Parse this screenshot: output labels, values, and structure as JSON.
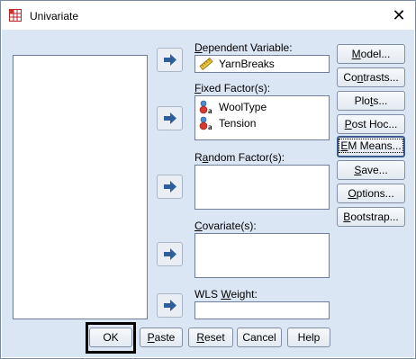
{
  "window": {
    "title": "Univariate",
    "close_glyph": "✕"
  },
  "fields": {
    "dependent": {
      "label": "Dependent Variable:",
      "underline": "D",
      "rest": "ependent Variable:",
      "items": [
        "YarnBreaks"
      ]
    },
    "fixed": {
      "label": "Fixed Factor(s):",
      "underline": "F",
      "rest": "ixed Factor(s):",
      "items": [
        "WoolType",
        "Tension"
      ]
    },
    "random": {
      "label": "Random Factor(s):",
      "pre": "R",
      "underline": "a",
      "rest": "ndom Factor(s):"
    },
    "covariate": {
      "label": "Covariate(s):",
      "underline": "C",
      "rest": "ovariate(s):"
    },
    "wls": {
      "label": "WLS Weight:",
      "pre": "WLS ",
      "underline": "W",
      "rest": "eight:"
    }
  },
  "side_buttons": [
    {
      "label": "Model...",
      "pre": "",
      "u": "M",
      "rest": "odel..."
    },
    {
      "label": "Contrasts...",
      "pre": "Co",
      "u": "n",
      "rest": "trasts..."
    },
    {
      "label": "Plots...",
      "pre": "Plo",
      "u": "t",
      "rest": "s..."
    },
    {
      "label": "Post Hoc...",
      "pre": "",
      "u": "P",
      "rest": "ost Hoc..."
    },
    {
      "label": "EM Means...",
      "pre": "",
      "u": "E",
      "rest": "M Means..."
    },
    {
      "label": "Save...",
      "pre": "",
      "u": "S",
      "rest": "ave..."
    },
    {
      "label": "Options...",
      "pre": "",
      "u": "O",
      "rest": "ptions..."
    },
    {
      "label": "Bootstrap...",
      "pre": "",
      "u": "B",
      "rest": "ootstrap..."
    }
  ],
  "bottom_buttons": {
    "ok": "OK",
    "paste": {
      "u": "P",
      "rest": "aste"
    },
    "reset": {
      "u": "R",
      "rest": "eset"
    },
    "cancel": "Cancel",
    "help": "Help"
  },
  "colors": {
    "client_bg": "#dbe6f4",
    "arrow": "#2e5f9c",
    "scale_icon": "#d4a017",
    "nominal_red": "#c0392b"
  }
}
